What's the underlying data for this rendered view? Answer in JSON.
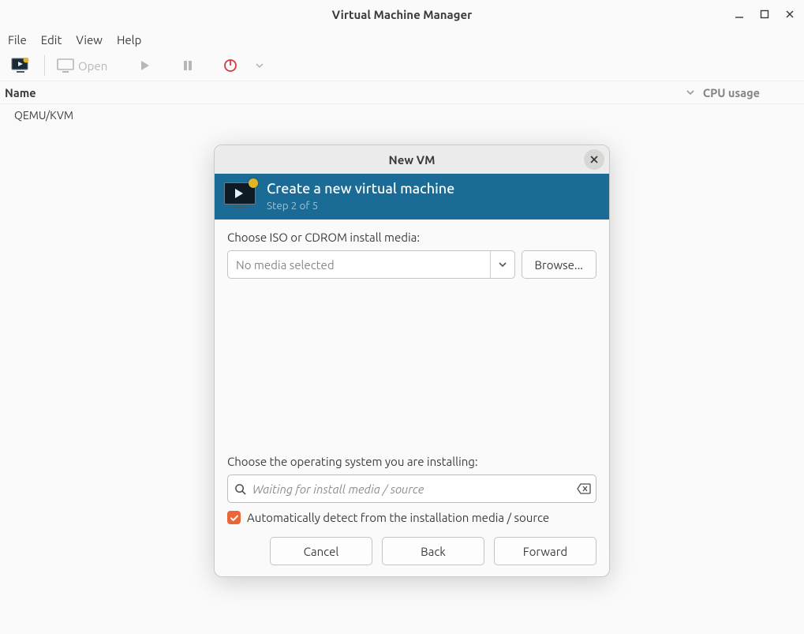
{
  "window": {
    "title": "Virtual Machine Manager"
  },
  "menubar": {
    "file": "File",
    "edit": "Edit",
    "view": "View",
    "help": "Help"
  },
  "toolbar": {
    "open_label": "Open"
  },
  "list": {
    "header_name": "Name",
    "header_cpu": "CPU usage",
    "row0": "QEMU/KVM"
  },
  "dialog": {
    "title": "New VM",
    "banner_title": "Create a new virtual machine",
    "banner_step": "Step 2 of 5",
    "media_label": "Choose ISO or CDROM install media:",
    "media_combo_text": "No media selected",
    "browse_label": "Browse...",
    "os_label": "Choose the operating system you are installing:",
    "os_placeholder": "Waiting for install media / source",
    "autodetect_label": "Automatically detect from the installation media / source",
    "btn_cancel": "Cancel",
    "btn_back": "Back",
    "btn_forward": "Forward"
  }
}
